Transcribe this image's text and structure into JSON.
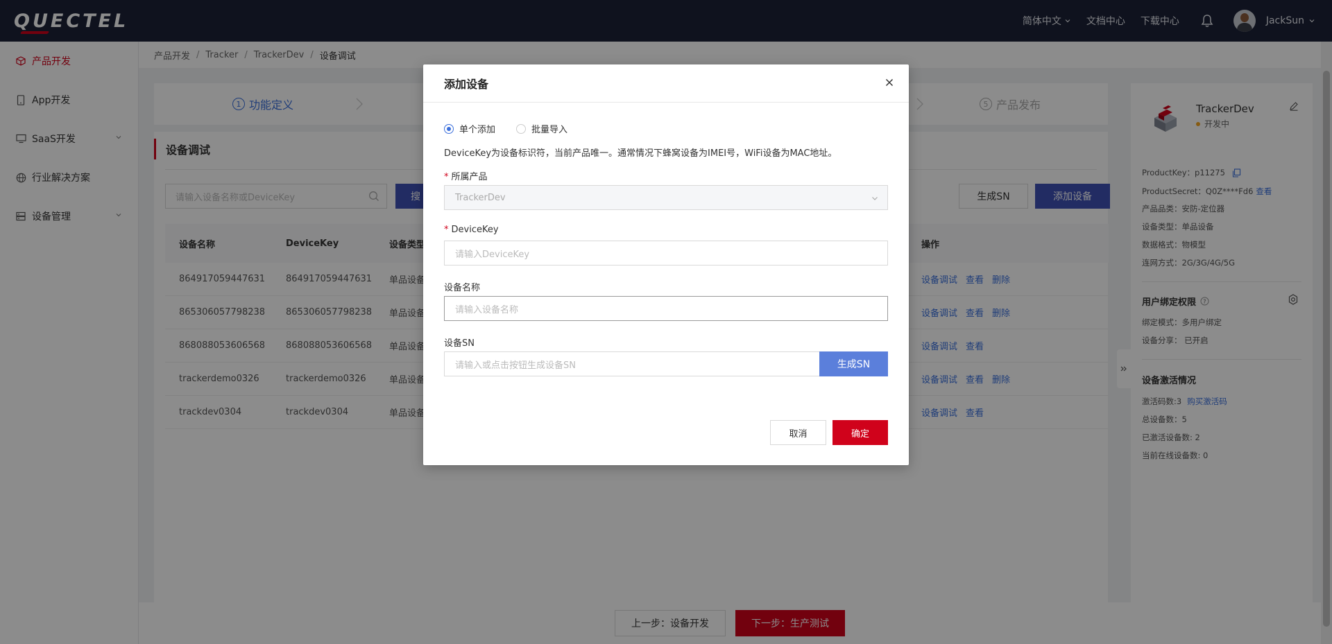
{
  "header": {
    "logo": "QUECTEL",
    "language": "简体中文",
    "docs": "文档中心",
    "downloads": "下载中心",
    "username": "JackSun"
  },
  "sidebar": {
    "items": [
      {
        "label": "产品开发",
        "icon": "cube-icon"
      },
      {
        "label": "App开发",
        "icon": "phone-icon"
      },
      {
        "label": "SaaS开发",
        "icon": "monitor-icon"
      },
      {
        "label": "行业解决方案",
        "icon": "globe-icon"
      },
      {
        "label": "设备管理",
        "icon": "server-icon"
      }
    ]
  },
  "breadcrumb": [
    "产品开发",
    "Tracker",
    "TrackerDev",
    "设备调试"
  ],
  "steps": [
    {
      "num": "1",
      "label": "功能定义"
    },
    {
      "num": "5",
      "label": "产品发布"
    }
  ],
  "card": {
    "title": "设备调试",
    "search_placeholder": "请输入设备名称或DeviceKey",
    "search_label": "搜",
    "gen_sn": "生成SN",
    "add_device": "添加设备"
  },
  "table": {
    "headers": [
      "设备名称",
      "DeviceKey",
      "设备类型",
      "操作"
    ],
    "rows": [
      {
        "name": "864917059447631",
        "key": "864917059447631",
        "type": "单品设备",
        "ops": [
          "设备调试",
          "查看",
          "删除"
        ]
      },
      {
        "name": "865306057798238",
        "key": "865306057798238",
        "type": "单品设备",
        "ops": [
          "设备调试",
          "查看",
          "删除"
        ]
      },
      {
        "name": "868088053606568",
        "key": "868088053606568",
        "type": "单品设备",
        "ops": [
          "设备调试",
          "查看"
        ]
      },
      {
        "name": "trackerdemo0326",
        "key": "trackerdemo0326",
        "type": "单品设备",
        "ops": [
          "设备调试",
          "查看",
          "删除"
        ]
      },
      {
        "name": "trackdev0304",
        "key": "trackdev0304",
        "type": "单品设备",
        "ops": [
          "设备调试",
          "查看"
        ]
      }
    ]
  },
  "product": {
    "name": "TrackerDev",
    "status": "开发中",
    "product_key": "ProductKey：p11275",
    "product_secret": "ProductSecret：Q0Z****Fd6",
    "view": "查看",
    "category": "产品品类：安防-定位器",
    "device_type": "设备类型：单品设备",
    "data_format": "数据格式：物模型",
    "network": "连网方式：2G/3G/4G/5G",
    "binding_title": "用户绑定权限",
    "binding_mode": "绑定模式：多用户绑定",
    "sharing": "设备分享：  已开启",
    "activation_title": "设备激活情况",
    "activation_codes": "激活码数:3",
    "buy_codes": "购买激活码",
    "total_devices": "总设备数：5",
    "activated": "已激活设备数: 2",
    "online": "当前在线设备数: 0"
  },
  "bottom": {
    "prev": "上一步：设备开发",
    "next": "下一步：生产测试"
  },
  "modal": {
    "title": "添加设备",
    "radio_single": "单个添加",
    "radio_batch": "批量导入",
    "description": "DeviceKey为设备标识符，当前产品唯一。通常情况下蜂窝设备为IMEI号，WiFi设备为MAC地址。",
    "product_label": "所属产品",
    "product_value": "TrackerDev",
    "devicekey_label": "DeviceKey",
    "devicekey_placeholder": "请输入DeviceKey",
    "name_label": "设备名称",
    "name_placeholder": "请输入设备名称",
    "sn_label": "设备SN",
    "sn_placeholder": "请输入或点击按钮生成设备SN",
    "sn_button": "生成SN",
    "cancel": "取消",
    "confirm": "确定"
  }
}
